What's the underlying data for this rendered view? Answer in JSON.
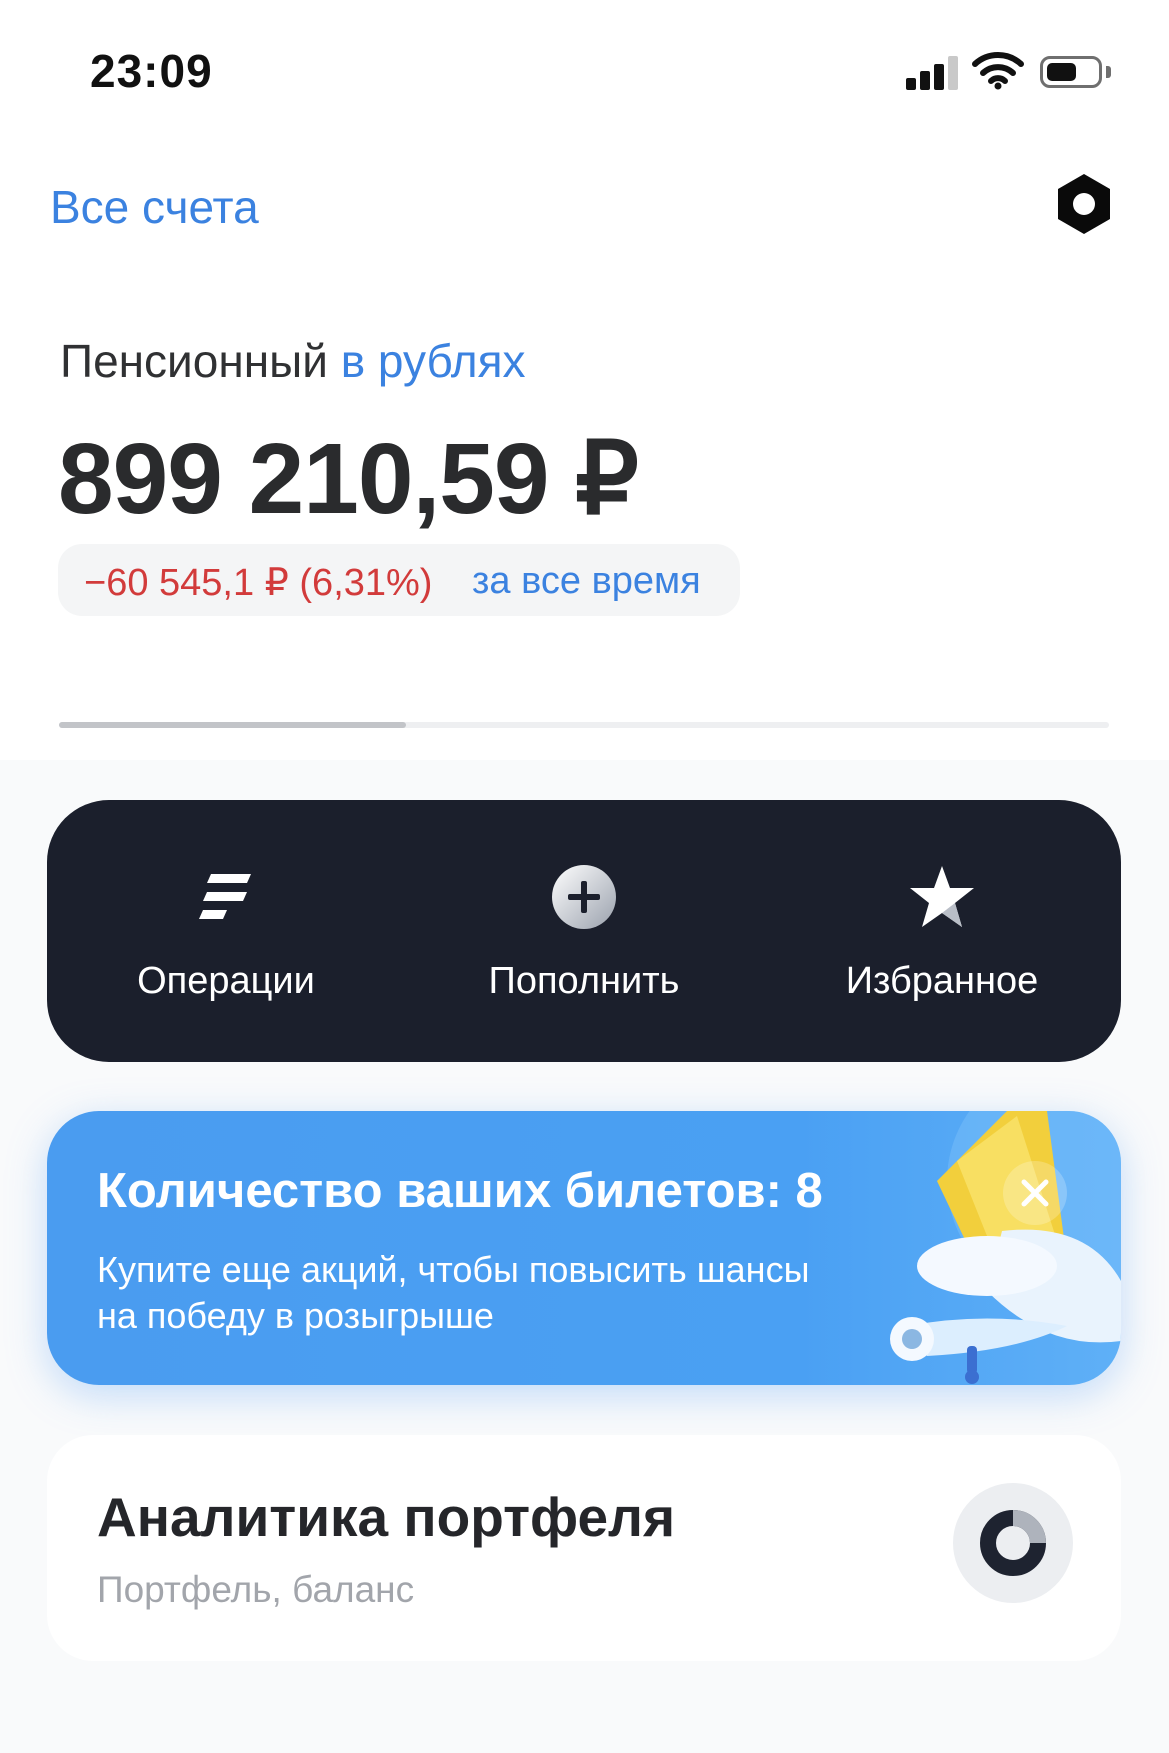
{
  "status_bar": {
    "time": "23:09",
    "battery_level": 0.6
  },
  "header": {
    "all_accounts_link": "Все счета",
    "settings_icon": "settings-hex-icon"
  },
  "account": {
    "name": "Пенсионный",
    "currency_label": "в рублях",
    "balance": "899 210,59 ₽",
    "change_value": "−60 545,1 ₽ (6,31%)",
    "change_period": "за все время",
    "page_progress": 0.33
  },
  "actions": [
    {
      "label": "Операции",
      "icon": "operations-icon"
    },
    {
      "label": "Пополнить",
      "icon": "plus-circle-icon"
    },
    {
      "label": "Избранное",
      "icon": "star-icon"
    }
  ],
  "promo": {
    "title": "Количество ваших билетов: 8",
    "subtitle": "Купите еще акций, чтобы повысить шансы на победу в розыгрыше",
    "close_icon": "close-icon"
  },
  "analytics": {
    "title": "Аналитика портфеля",
    "subtitle": "Портфель, баланс",
    "icon": "donut-chart-icon"
  },
  "colors": {
    "accent": "#3b82e0",
    "negative": "#d23b3b",
    "dark_card": "#1b1f2c",
    "promo": "#4a9cf0"
  }
}
